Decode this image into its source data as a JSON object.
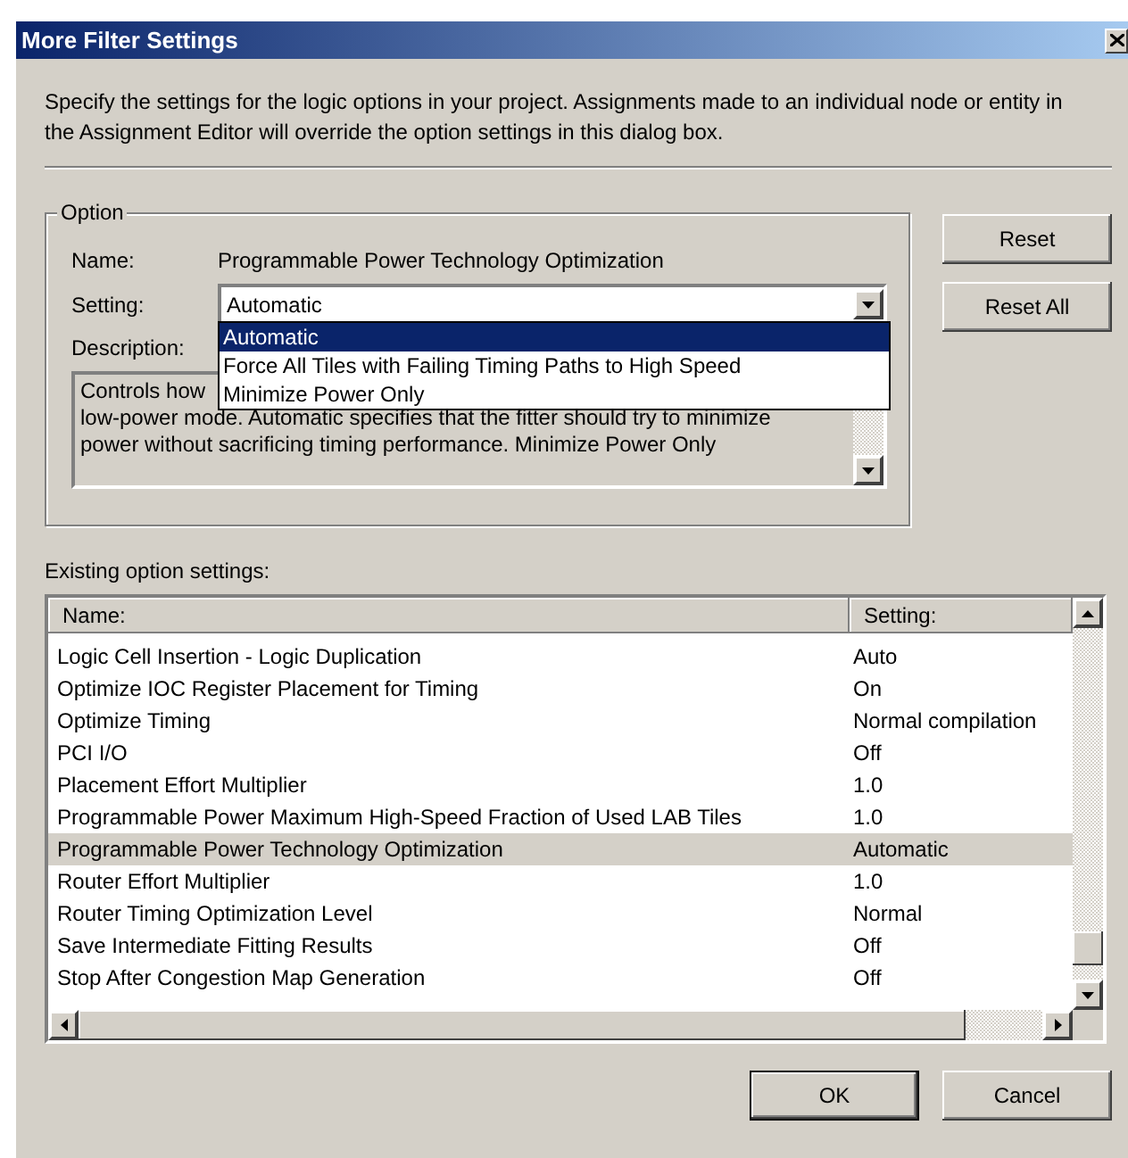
{
  "window": {
    "title": "More Filter Settings"
  },
  "intro": "Specify the settings for the logic options in your project.  Assignments made to an individual node or entity in the Assignment Editor will override the option settings in this dialog box.",
  "option": {
    "group_label": "Option",
    "name_label": "Name:",
    "name_value": "Programmable Power Technology Optimization",
    "setting_label": "Setting:",
    "setting_value": "Automatic",
    "dropdown": {
      "expanded": true,
      "items": [
        {
          "label": "Automatic",
          "selected": true
        },
        {
          "label": "Force All Tiles with Failing Timing Paths to High Speed",
          "selected": false
        },
        {
          "label": "Minimize Power Only",
          "selected": false
        }
      ]
    },
    "description_label": "Description:",
    "description_lines": [
      "Controls how",
      "low-power mode. Automatic specifies that the fitter should try to minimize",
      "power without sacrificing timing performance. Minimize Power Only"
    ]
  },
  "side_buttons": [
    "Reset",
    "Reset All"
  ],
  "existing": {
    "label": "Existing option settings:",
    "columns": [
      "Name:",
      "Setting:"
    ],
    "rows": [
      {
        "name": "Logic Cell Insertion - Logic Duplication",
        "setting": "Auto",
        "selected": false
      },
      {
        "name": "Optimize IOC Register Placement for Timing",
        "setting": "On",
        "selected": false
      },
      {
        "name": "Optimize Timing",
        "setting": "Normal compilation",
        "selected": false
      },
      {
        "name": "PCI I/O",
        "setting": "Off",
        "selected": false
      },
      {
        "name": "Placement Effort Multiplier",
        "setting": "1.0",
        "selected": false
      },
      {
        "name": "Programmable Power Maximum High-Speed Fraction of Used LAB Tiles",
        "setting": "1.0",
        "selected": false
      },
      {
        "name": "Programmable Power Technology Optimization",
        "setting": "Automatic",
        "selected": true
      },
      {
        "name": "Router Effort Multiplier",
        "setting": "1.0",
        "selected": false
      },
      {
        "name": "Router Timing Optimization Level",
        "setting": "Normal",
        "selected": false
      },
      {
        "name": "Save Intermediate Fitting Results",
        "setting": "Off",
        "selected": false
      },
      {
        "name": "Stop After Congestion Map Generation",
        "setting": "Off",
        "selected": false
      }
    ]
  },
  "buttons": [
    {
      "label": "OK",
      "default": true
    },
    {
      "label": "Cancel",
      "default": false
    }
  ]
}
